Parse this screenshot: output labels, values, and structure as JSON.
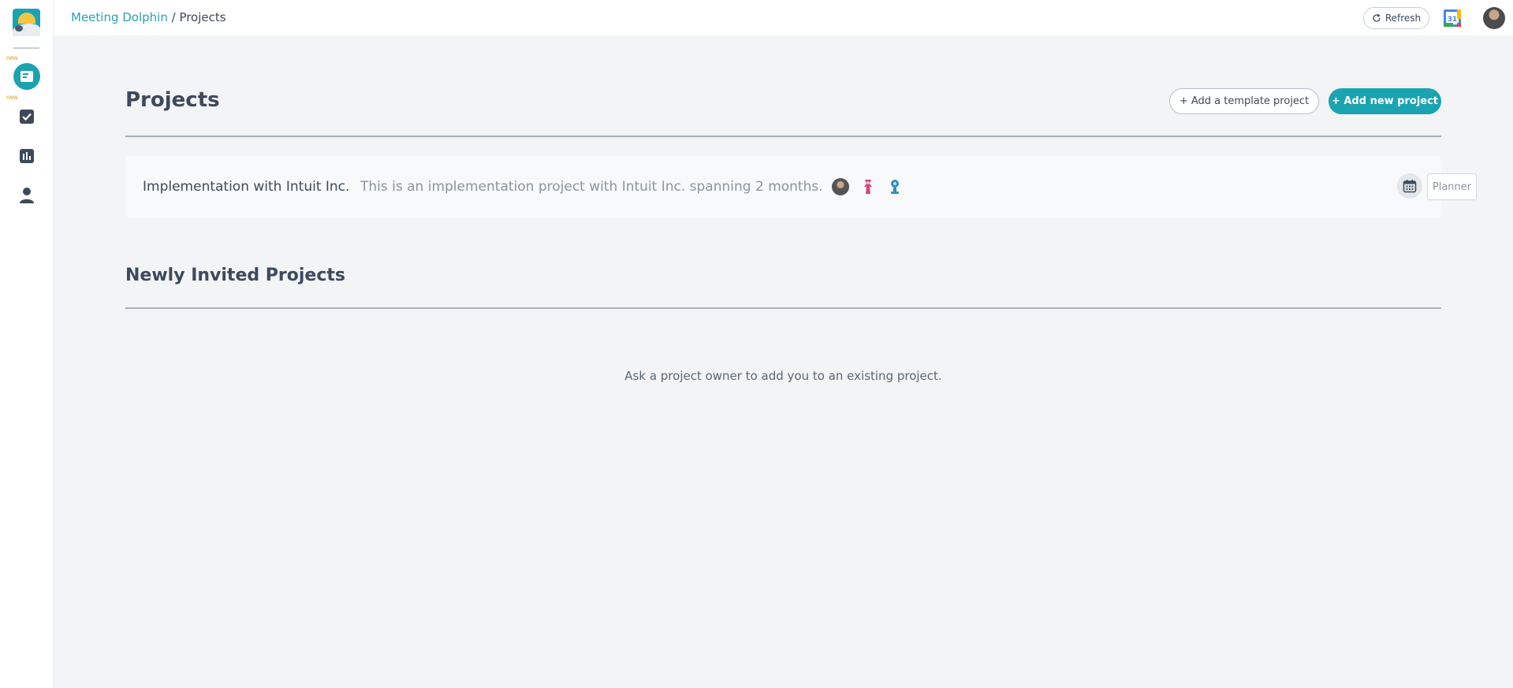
{
  "sidebar": {
    "logo_icon": "meeting-dolphin-logo",
    "new_badge_1": "new",
    "new_badge_2": "new",
    "items": [
      {
        "icon": "meetings-icon",
        "active": true
      },
      {
        "icon": "tasks-icon",
        "active": false
      },
      {
        "icon": "analytics-icon",
        "active": false
      },
      {
        "icon": "profile-icon",
        "active": false
      }
    ]
  },
  "breadcrumb": {
    "root": "Meeting Dolphin",
    "separator": " / ",
    "current": "Projects"
  },
  "toolbar": {
    "refresh_label": "Refresh",
    "calendar_icon": "google-calendar-icon",
    "calendar_day": "31"
  },
  "projects": {
    "title": "Projects",
    "add_template_label": "+ Add a template project",
    "add_new_label": "+ Add new project",
    "items": [
      {
        "name": "Implementation with Intuit Inc.",
        "description": "This is an implementation project with Intuit Inc. spanning 2 months.",
        "planner_label": "Planner"
      }
    ]
  },
  "invited": {
    "title": "Newly Invited Projects",
    "empty_message": "Ask a project owner to add you to an existing project."
  },
  "colors": {
    "accent": "#1aa3b0",
    "text": "#3d4a5c",
    "muted": "#8a94a2",
    "background": "#f2f4f6"
  }
}
